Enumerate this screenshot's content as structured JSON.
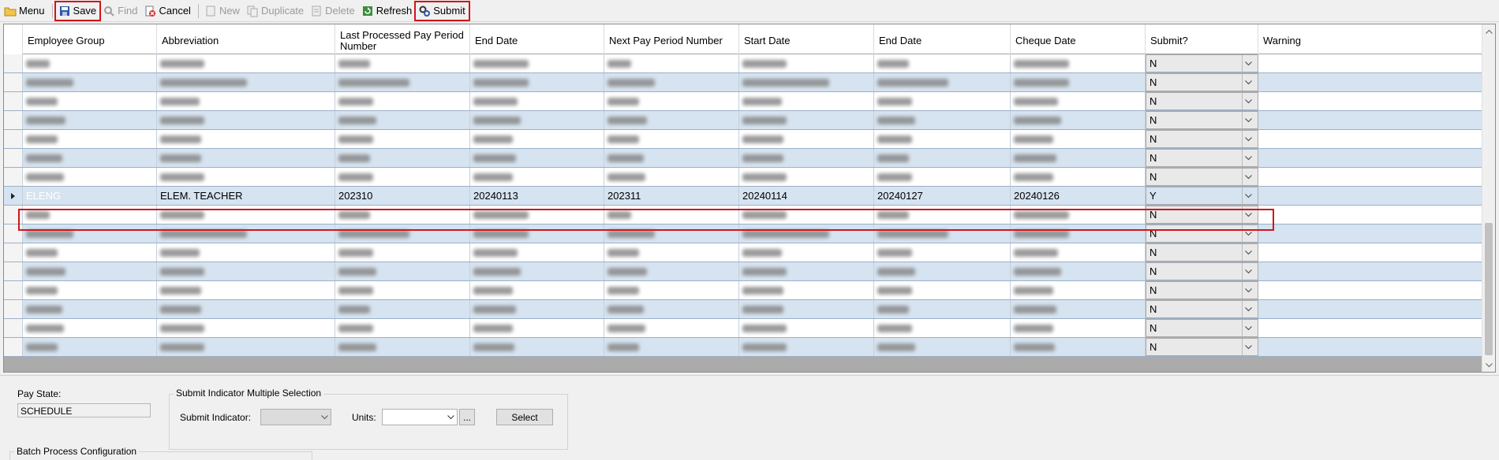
{
  "toolbar": {
    "menu": "Menu",
    "save": "Save",
    "find": "Find",
    "cancel": "Cancel",
    "new": "New",
    "duplicate": "Duplicate",
    "delete": "Delete",
    "refresh": "Refresh",
    "submit": "Submit"
  },
  "grid": {
    "columns": [
      "Employee Group",
      "Abbreviation",
      "Last Processed Pay Period Number",
      "End Date",
      "Next Pay Period Number",
      "Start Date",
      "End Date",
      "Cheque Date",
      "Submit?",
      "Warning"
    ],
    "selected_row": {
      "employee_group": "ELENG",
      "abbreviation": "ELEM. TEACHER",
      "last_processed": "202310",
      "end_date": "20240113",
      "next_pay_period": "202311",
      "start_date": "20240114",
      "end_date_2": "20240127",
      "cheque_date": "20240126",
      "submit": "Y",
      "warning": ""
    },
    "other_rows_submit_value": "N",
    "rows_above": 7,
    "rows_below": 8
  },
  "bottom": {
    "pay_state_label": "Pay State:",
    "pay_state_value": "SCHEDULE",
    "multi_sel_title": "Submit Indicator Multiple Selection",
    "submit_indicator_label": "Submit Indicator:",
    "units_label": "Units:",
    "ellipsis_button": "...",
    "select_button": "Select",
    "batch_title": "Batch Process Configuration"
  },
  "colors": {
    "accent_highlight": "#d3141b",
    "selection_blue": "#0a74d3",
    "alt_row": "#d6e3f0"
  },
  "icons": [
    "folder-icon",
    "save-icon",
    "find-icon",
    "cancel-icon",
    "new-icon",
    "duplicate-icon",
    "delete-icon",
    "refresh-icon",
    "submit-icon"
  ]
}
